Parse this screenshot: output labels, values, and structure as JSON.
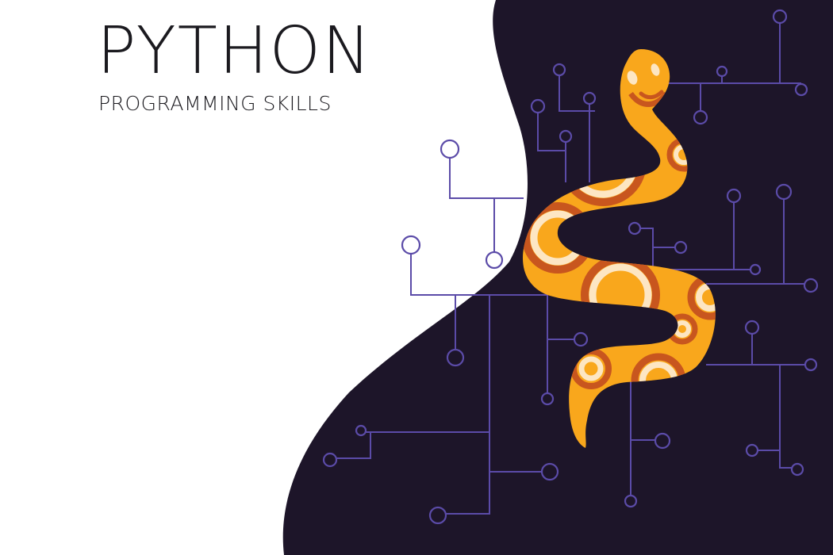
{
  "heading": {
    "title": "PYTHON",
    "subtitle": "PROGRAMMING SKILLS"
  },
  "colors": {
    "background": "#ffffff",
    "dark_panel": "#1d1529",
    "circuit": "#5b4ba8",
    "snake_body": "#f9a71c",
    "snake_stripe": "#c8561e",
    "snake_light": "#fde6c3",
    "text": "#1b1a1f"
  },
  "illustration": {
    "subject": "snake-icon",
    "background": "circuit-board-pattern"
  }
}
